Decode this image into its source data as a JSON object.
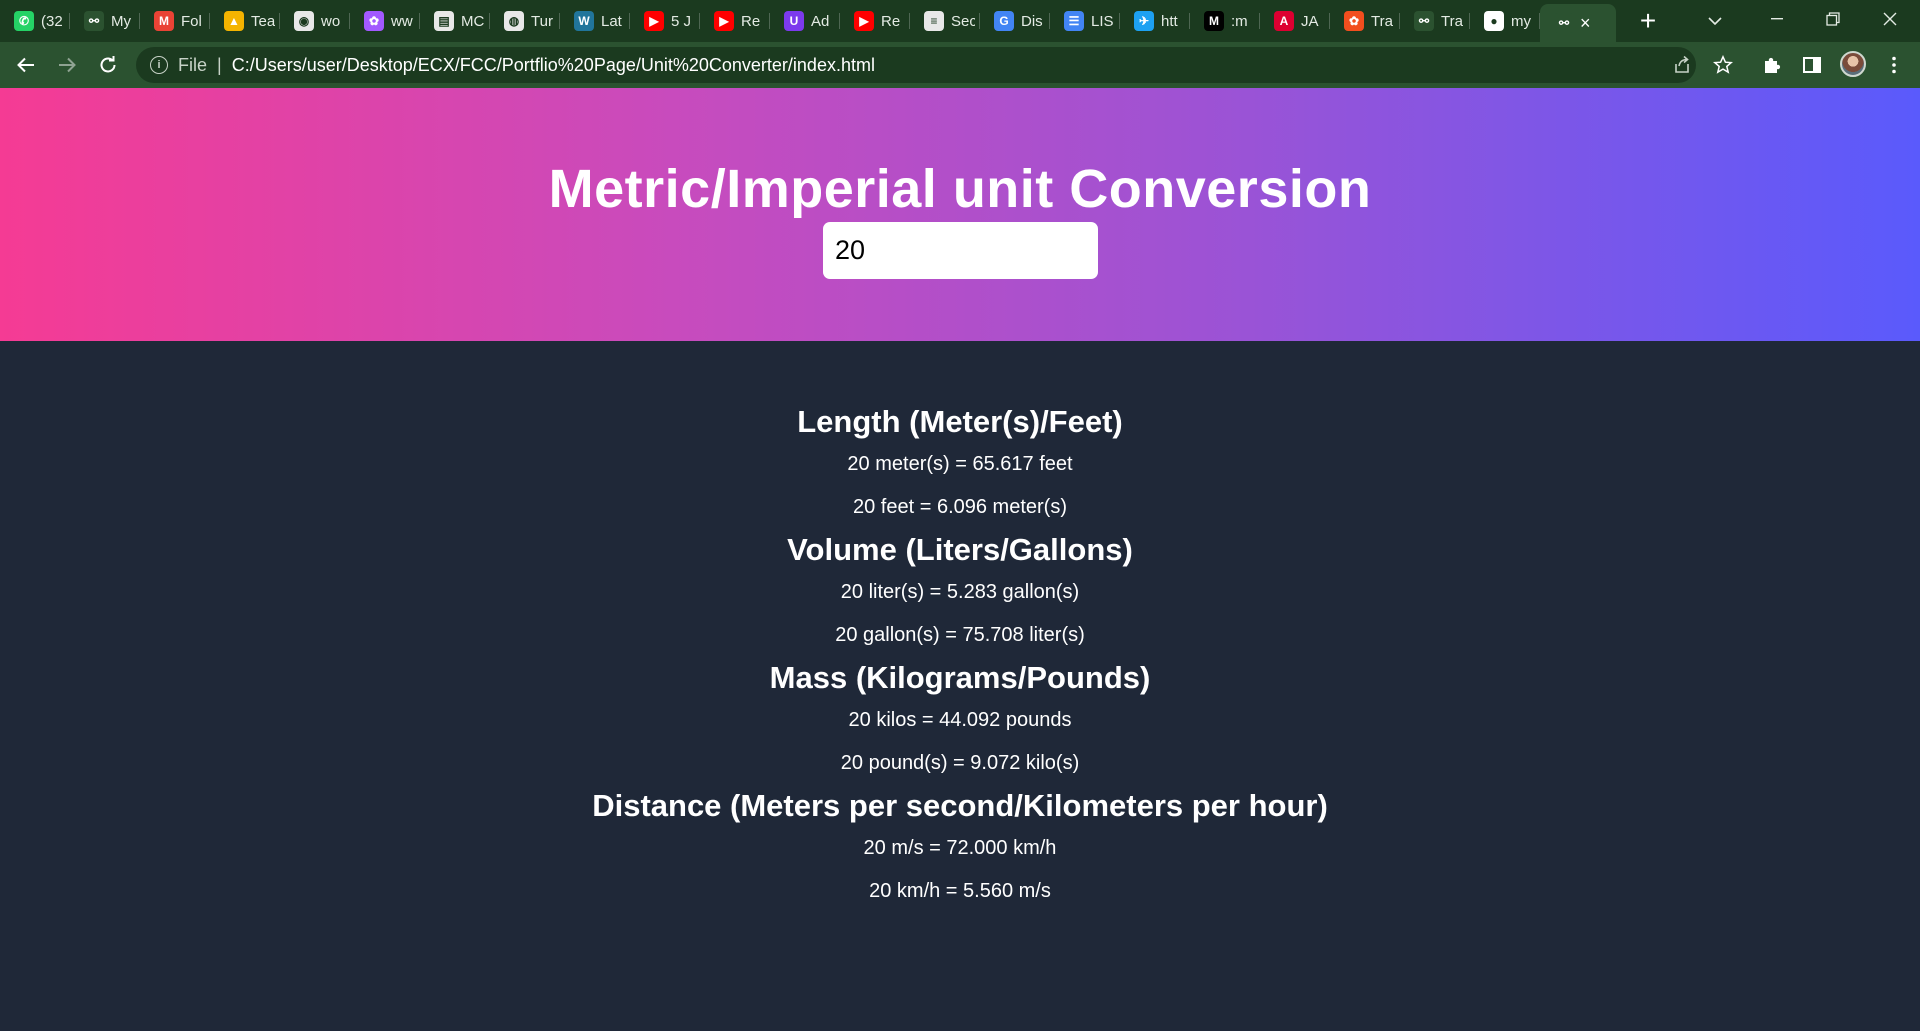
{
  "browser": {
    "tabs": [
      {
        "title": "(32",
        "icon": "whatsapp-icon",
        "color": "#25d366",
        "glyph": "✆"
      },
      {
        "title": "My",
        "icon": "freecodecamp-icon",
        "color": "#2b5230",
        "glyph": "⚯"
      },
      {
        "title": "Fol",
        "icon": "gmail-icon",
        "color": "#ea4335",
        "glyph": "M"
      },
      {
        "title": "Tea",
        "icon": "google-drive-icon",
        "color": "#f4b400",
        "glyph": "▲"
      },
      {
        "title": "wo",
        "icon": "alien-icon",
        "color": "#e8e8e8",
        "glyph": "◉"
      },
      {
        "title": "ww",
        "icon": "figma-icon",
        "color": "#a259ff",
        "glyph": "✿"
      },
      {
        "title": "MC",
        "icon": "document-icon",
        "color": "#e8e8e8",
        "glyph": "▤"
      },
      {
        "title": "Tur",
        "icon": "globe-icon",
        "color": "#e8e8e8",
        "glyph": "◍"
      },
      {
        "title": "Lat",
        "icon": "wordpress-icon",
        "color": "#21759b",
        "glyph": "W"
      },
      {
        "title": "5 J",
        "icon": "youtube-icon",
        "color": "#ff0000",
        "glyph": "▶"
      },
      {
        "title": "Re",
        "icon": "youtube-icon",
        "color": "#ff0000",
        "glyph": "▶"
      },
      {
        "title": "Ad",
        "icon": "extension-u-icon",
        "color": "#7c3aed",
        "glyph": "U"
      },
      {
        "title": "Re",
        "icon": "youtube-icon",
        "color": "#ff0000",
        "glyph": "▶"
      },
      {
        "title": "Sec",
        "icon": "steps-icon",
        "color": "#e8e8e8",
        "glyph": "≡"
      },
      {
        "title": "Dis",
        "icon": "google-icon",
        "color": "#4285f4",
        "glyph": "G"
      },
      {
        "title": "LIS",
        "icon": "list-doc-icon",
        "color": "#4285f4",
        "glyph": "☰"
      },
      {
        "title": "htt",
        "icon": "twitter-icon",
        "color": "#1da1f2",
        "glyph": "✈"
      },
      {
        "title": ":m",
        "icon": "medium-icon",
        "color": "#000000",
        "glyph": "M"
      },
      {
        "title": "JA",
        "icon": "angular-icon",
        "color": "#dd0031",
        "glyph": "A"
      },
      {
        "title": "Tra",
        "icon": "figma-icon",
        "color": "#f24e1e",
        "glyph": "✿"
      },
      {
        "title": "Tra",
        "icon": "freecodecamp-icon",
        "color": "#2b5230",
        "glyph": "⚯"
      },
      {
        "title": "my",
        "icon": "github-icon",
        "color": "#ffffff",
        "glyph": "●"
      }
    ],
    "active_tab": {
      "icon": "freecodecamp-icon",
      "glyph": "⚯",
      "close": "×"
    },
    "newtab_label": "+",
    "scheme": "File",
    "separator": "|",
    "url": "C:/Users/user/Desktop/ECX/FCC/Portflio%20Page/Unit%20Converter/index.html",
    "info_glyph": "i"
  },
  "page": {
    "title": "Metric/Imperial unit Conversion",
    "input_value": "20",
    "sections": [
      {
        "heading": "Length (Meter(s)/Feet)",
        "line1": "20 meter(s) = 65.617 feet",
        "line2": "20 feet = 6.096 meter(s)"
      },
      {
        "heading": "Volume (Liters/Gallons)",
        "line1": "20 liter(s) = 5.283 gallon(s)",
        "line2": "20 gallon(s) = 75.708 liter(s)"
      },
      {
        "heading": "Mass (Kilograms/Pounds)",
        "line1": "20 kilos = 44.092 pounds",
        "line2": "20 pound(s) = 9.072 kilo(s)"
      },
      {
        "heading": "Distance (Meters per second/Kilometers per hour)",
        "line1": "20 m/s = 72.000 km/h",
        "line2": "20 km/h = 5.560 m/s"
      }
    ]
  },
  "colors": {
    "chrome_frame": "#1b3a1f",
    "chrome_toolbar": "#2b5230",
    "page_background": "#1f2838",
    "hero_gradient_start": "#f53b94",
    "hero_gradient_end": "#5a5afc"
  }
}
